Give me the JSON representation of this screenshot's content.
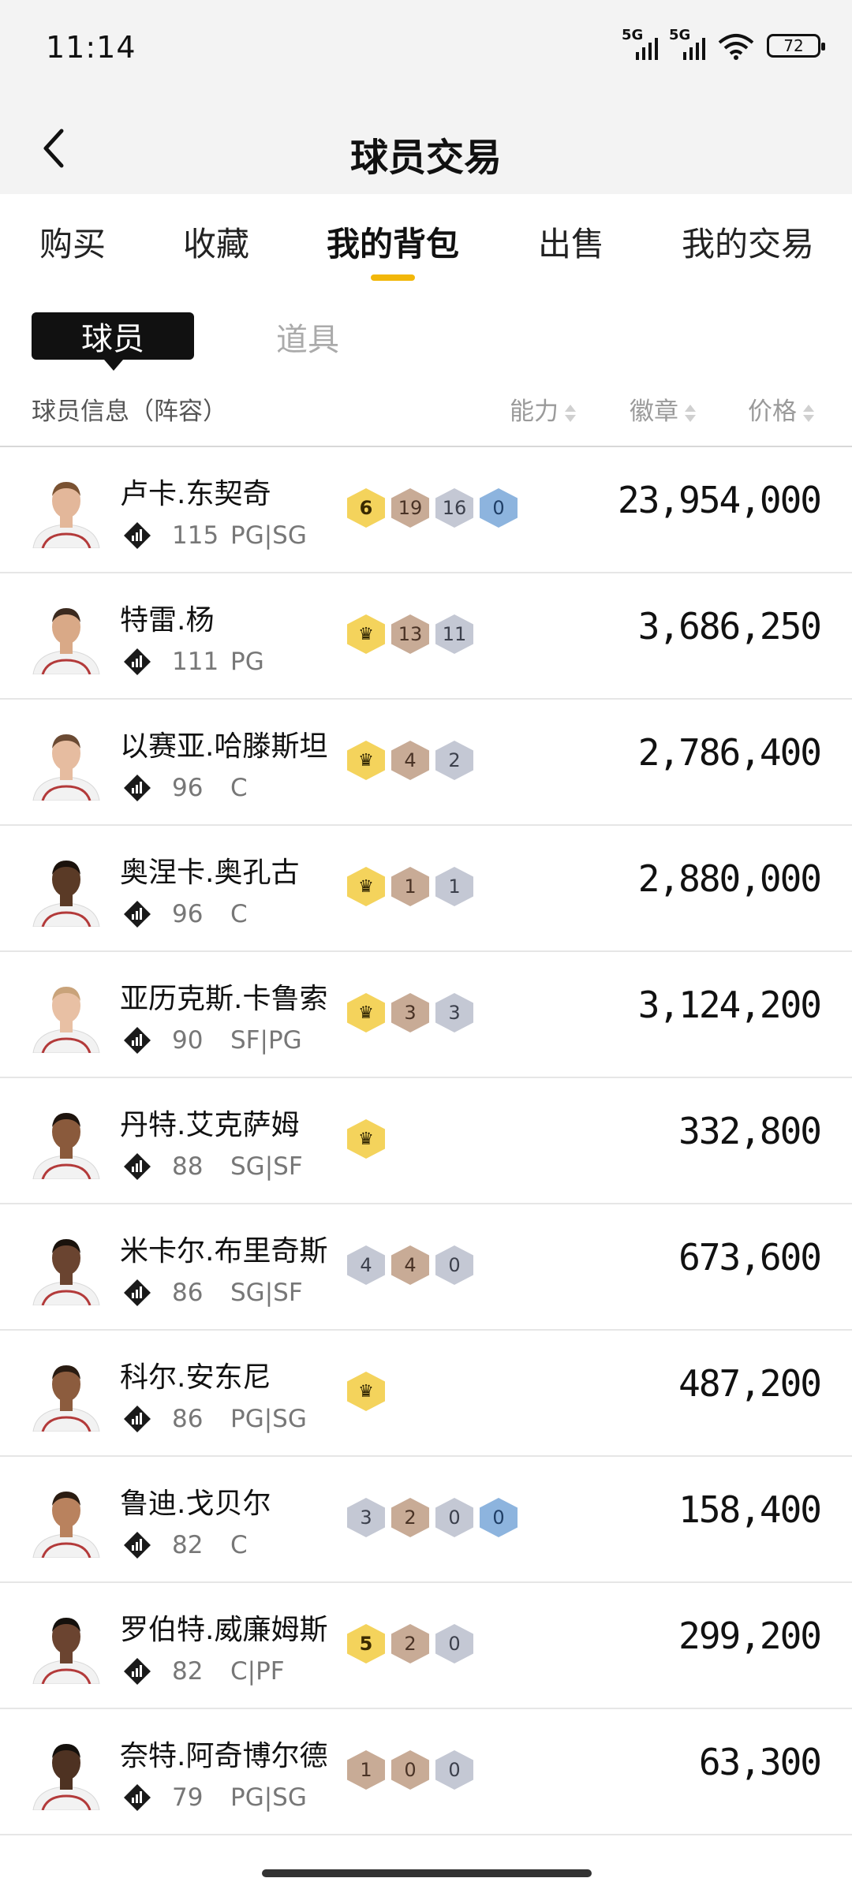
{
  "status": {
    "time": "11:14",
    "network1": "5G",
    "network2": "5G",
    "battery": "72"
  },
  "header": {
    "title": "球员交易"
  },
  "tabs": [
    {
      "label": "购买"
    },
    {
      "label": "收藏"
    },
    {
      "label": "我的背包",
      "active": true
    },
    {
      "label": "出售"
    },
    {
      "label": "我的交易"
    }
  ],
  "subtabs": {
    "active": "球员",
    "other": "道具"
  },
  "columns": {
    "info": "球员信息（阵容）",
    "ability": "能力",
    "badges": "徽章",
    "price": "价格"
  },
  "players": [
    {
      "name": "卢卡.东契奇",
      "ovr": "115",
      "pos": "PG|SG",
      "badges": [
        {
          "type": "gold",
          "text": "6"
        },
        {
          "type": "bronze",
          "text": "19"
        },
        {
          "type": "silver",
          "text": "16"
        },
        {
          "type": "blue",
          "text": "0"
        }
      ],
      "price": "23,954,000",
      "skin": "#e3b79a",
      "hair": "#7a5232"
    },
    {
      "name": "特雷.杨",
      "ovr": "111",
      "pos": "PG",
      "badges": [
        {
          "type": "crown",
          "text": "♛"
        },
        {
          "type": "bronze",
          "text": "13"
        },
        {
          "type": "silver",
          "text": "11"
        }
      ],
      "price": "3,686,250",
      "skin": "#d9a987",
      "hair": "#3b2a1f"
    },
    {
      "name": "以赛亚.哈滕斯坦",
      "ovr": "96",
      "pos": "C",
      "badges": [
        {
          "type": "crown",
          "text": "♛"
        },
        {
          "type": "bronze",
          "text": "4"
        },
        {
          "type": "silver",
          "text": "2"
        }
      ],
      "price": "2,786,400",
      "skin": "#e6bca0",
      "hair": "#6b4a33"
    },
    {
      "name": "奥涅卡.奥孔古",
      "ovr": "96",
      "pos": "C",
      "badges": [
        {
          "type": "crown",
          "text": "♛"
        },
        {
          "type": "bronze",
          "text": "1"
        },
        {
          "type": "silver",
          "text": "1"
        }
      ],
      "price": "2,880,000",
      "skin": "#5a3a26",
      "hair": "#1b120c"
    },
    {
      "name": "亚历克斯.卡鲁索",
      "ovr": "90",
      "pos": "SF|PG",
      "badges": [
        {
          "type": "crown",
          "text": "♛"
        },
        {
          "type": "bronze",
          "text": "3"
        },
        {
          "type": "silver",
          "text": "3"
        }
      ],
      "price": "3,124,200",
      "skin": "#e8c0a4",
      "hair": "#c9a37a"
    },
    {
      "name": "丹特.艾克萨姆",
      "ovr": "88",
      "pos": "SG|SF",
      "badges": [
        {
          "type": "crown",
          "text": "♛"
        }
      ],
      "price": "332,800",
      "skin": "#8a5a3c",
      "hair": "#1e140e"
    },
    {
      "name": "米卡尔.布里奇斯",
      "ovr": "86",
      "pos": "SG|SF",
      "badges": [
        {
          "type": "silver",
          "text": "4"
        },
        {
          "type": "bronze",
          "text": "4"
        },
        {
          "type": "silver",
          "text": "0"
        }
      ],
      "price": "673,600",
      "skin": "#6a4430",
      "hair": "#1a120c"
    },
    {
      "name": "科尔.安东尼",
      "ovr": "86",
      "pos": "PG|SG",
      "badges": [
        {
          "type": "crown",
          "text": "♛"
        }
      ],
      "price": "487,200",
      "skin": "#8c5c3e",
      "hair": "#2a1c12"
    },
    {
      "name": "鲁迪.戈贝尔",
      "ovr": "82",
      "pos": "C",
      "badges": [
        {
          "type": "silver",
          "text": "3"
        },
        {
          "type": "bronze",
          "text": "2"
        },
        {
          "type": "silver",
          "text": "0"
        },
        {
          "type": "blue",
          "text": "0"
        }
      ],
      "price": "158,400",
      "skin": "#b9825e",
      "hair": "#2a1c12"
    },
    {
      "name": "罗伯特.威廉姆斯",
      "ovr": "82",
      "pos": "C|PF",
      "badges": [
        {
          "type": "gold",
          "text": "5"
        },
        {
          "type": "bronze",
          "text": "2"
        },
        {
          "type": "silver",
          "text": "0"
        }
      ],
      "price": "299,200",
      "skin": "#6b4430",
      "hair": "#14100c"
    },
    {
      "name": "奈特.阿奇博尔德",
      "ovr": "79",
      "pos": "PG|SG",
      "badges": [
        {
          "type": "bronze",
          "text": "1"
        },
        {
          "type": "bronze",
          "text": "0"
        },
        {
          "type": "silver",
          "text": "0"
        }
      ],
      "price": "63,300",
      "skin": "#4e3222",
      "hair": "#14100c"
    }
  ]
}
